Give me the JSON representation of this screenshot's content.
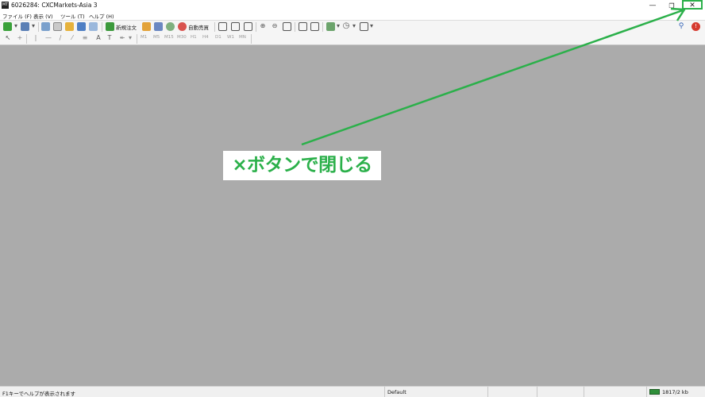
{
  "window": {
    "title": "6026284: CXCMarkets-Asia 3",
    "app_icon_text": "MT"
  },
  "menubar": [
    "ファイル (F)",
    "表示 (V)",
    "ツール (T)",
    "ヘルプ (H)"
  ],
  "toolbar": {
    "new_order_label": "新規注文",
    "auto_trade_label": "自動売買",
    "timeframes": [
      "M1",
      "M5",
      "M15",
      "M30",
      "H1",
      "H4",
      "D1",
      "W1",
      "MN"
    ]
  },
  "statusbar": {
    "help_text": "F1キーでヘルプが表示されます",
    "profile": "Default",
    "traffic": "1817/2 kb"
  },
  "annotation": {
    "callout_text": "×ボタンで閉じる",
    "color": "#2bb04a"
  },
  "colors": {
    "workspace": "#ababab",
    "accent_green": "#2bb04a"
  }
}
